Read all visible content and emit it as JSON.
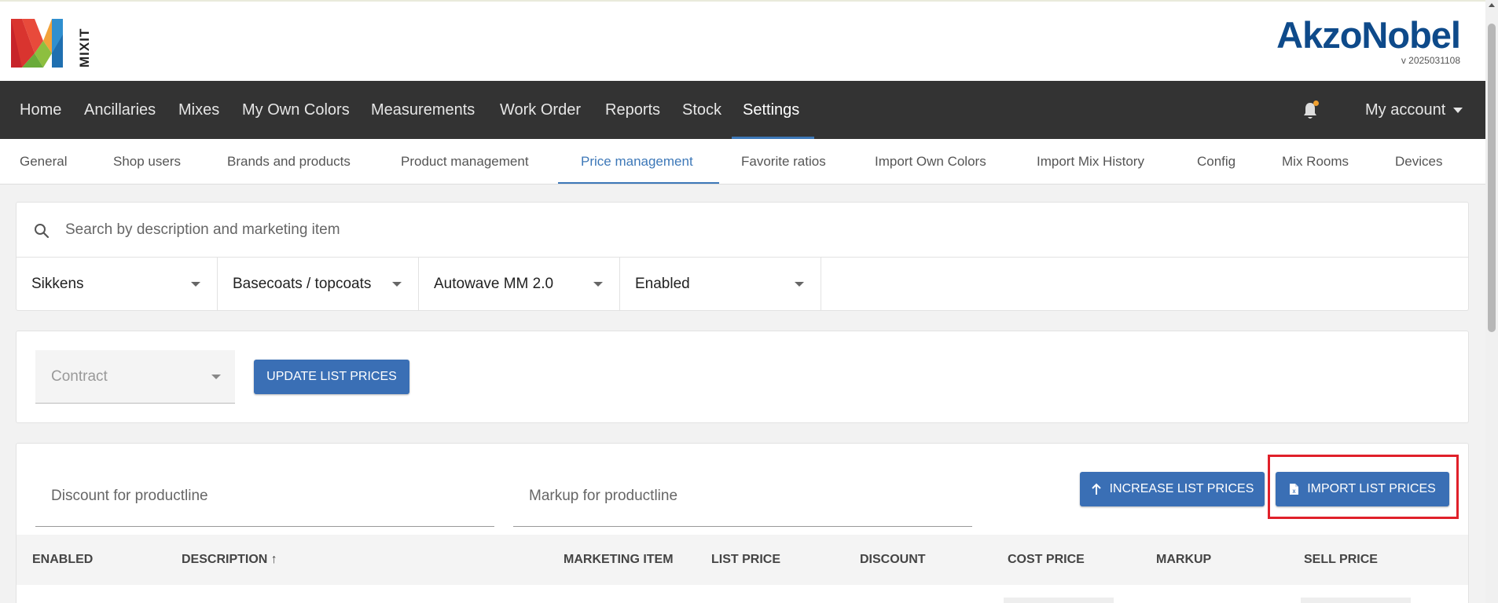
{
  "header": {
    "logo_text": "MIXIT",
    "brand": "AkzoNobel",
    "version": "v 2025031108"
  },
  "nav": {
    "items": [
      "Home",
      "Ancillaries",
      "Mixes",
      "My Own Colors",
      "Measurements",
      "Work Order",
      "Reports",
      "Stock",
      "Settings"
    ],
    "active": "Settings",
    "account": "My account"
  },
  "subnav": {
    "items": [
      "General",
      "Shop users",
      "Brands and products",
      "Product management",
      "Price management",
      "Favorite ratios",
      "Import Own Colors",
      "Import Mix History",
      "Config",
      "Mix Rooms",
      "Devices"
    ],
    "active": "Price management"
  },
  "search": {
    "placeholder": "Search by description and marketing item"
  },
  "filters": {
    "brand": "Sikkens",
    "category": "Basecoats / topcoats",
    "product": "Autowave MM 2.0",
    "status": "Enabled"
  },
  "contract": {
    "label": "Contract",
    "update_button": "UPDATE LIST PRICES"
  },
  "productline": {
    "discount_label": "Discount for productline",
    "markup_label": "Markup for productline",
    "increase_button": "INCREASE LIST PRICES",
    "import_button": "IMPORT LIST PRICES"
  },
  "table": {
    "columns": [
      "ENABLED",
      "DESCRIPTION",
      "MARKETING ITEM",
      "LIST PRICE",
      "DISCOUNT",
      "COST PRICE",
      "MARKUP",
      "SELL PRICE"
    ],
    "sort_indicator": "↑"
  },
  "colors": {
    "navbar": "#333333",
    "accent": "#3d78b8",
    "button": "#3a6fb5",
    "highlight": "#e0202a",
    "brand": "#0e4a8a"
  }
}
